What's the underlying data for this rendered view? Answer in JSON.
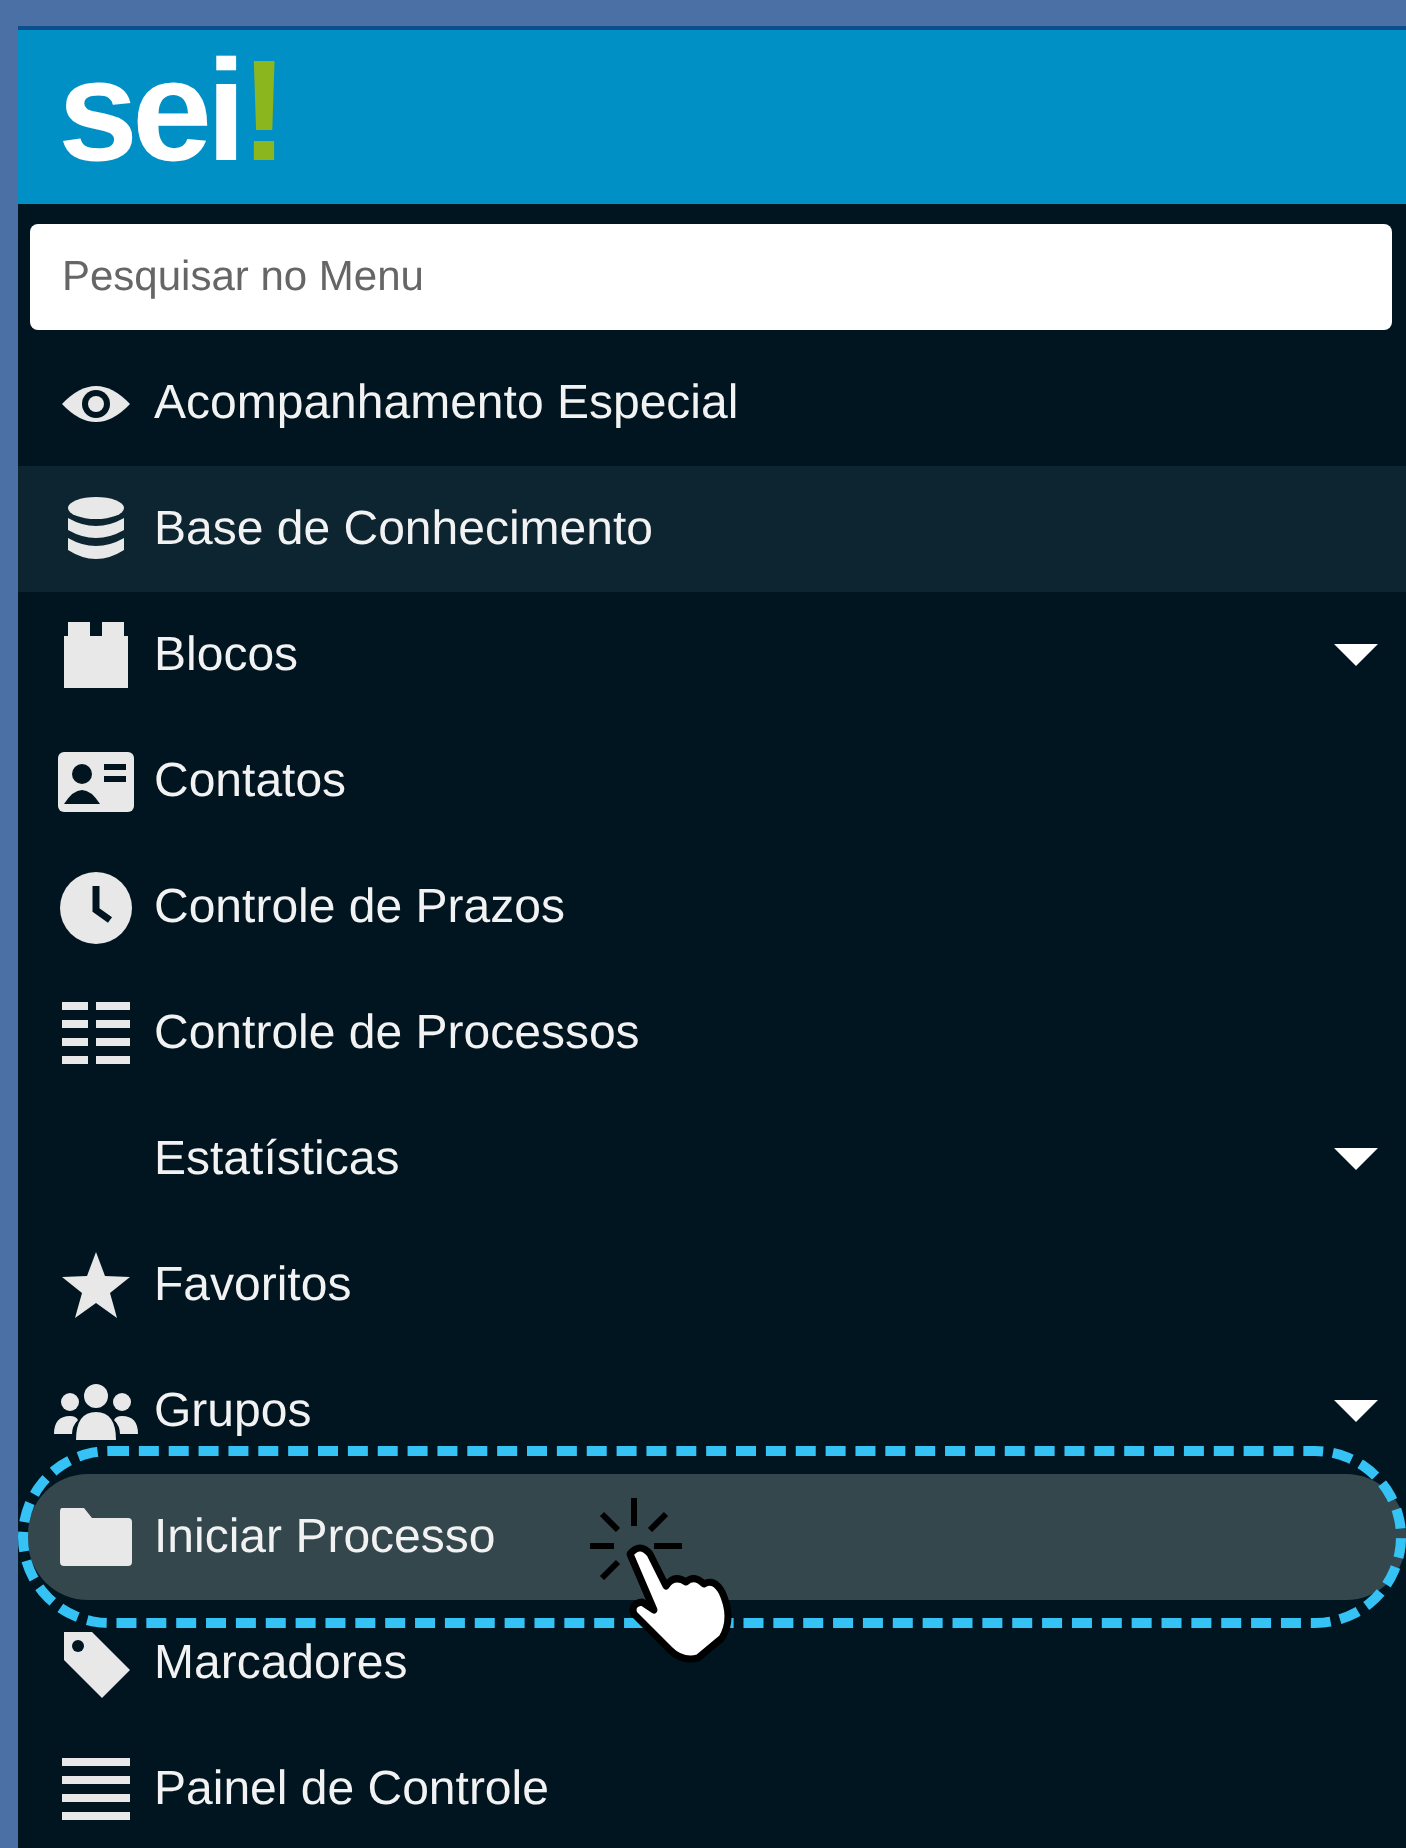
{
  "logo": "sei!",
  "search": {
    "placeholder": "Pesquisar no Menu"
  },
  "menu": [
    {
      "kind": "eye",
      "label": "Acompanhamento Especial",
      "submenu": false,
      "hovered": false,
      "selected": false
    },
    {
      "kind": "database",
      "label": "Base de Conhecimento",
      "submenu": false,
      "hovered": true,
      "selected": false
    },
    {
      "kind": "blocks",
      "label": "Blocos",
      "submenu": true,
      "hovered": false,
      "selected": false
    },
    {
      "kind": "card",
      "label": "Contatos",
      "submenu": false,
      "hovered": false,
      "selected": false
    },
    {
      "kind": "clock",
      "label": "Controle de Prazos",
      "submenu": false,
      "hovered": false,
      "selected": false
    },
    {
      "kind": "list",
      "label": "Controle de Processos",
      "submenu": false,
      "hovered": false,
      "selected": false
    },
    {
      "kind": "plain",
      "label": "Estatísticas",
      "submenu": true,
      "hovered": false,
      "selected": false
    },
    {
      "kind": "star",
      "label": "Favoritos",
      "submenu": false,
      "hovered": false,
      "selected": false
    },
    {
      "kind": "users",
      "label": "Grupos",
      "submenu": true,
      "hovered": false,
      "selected": false
    },
    {
      "kind": "folder",
      "label": "Iniciar Processo",
      "submenu": false,
      "hovered": false,
      "selected": true
    },
    {
      "kind": "tag",
      "label": "Marcadores",
      "submenu": false,
      "hovered": false,
      "selected": false
    },
    {
      "kind": "bars",
      "label": "Painel de Controle",
      "submenu": false,
      "hovered": false,
      "selected": false
    }
  ]
}
